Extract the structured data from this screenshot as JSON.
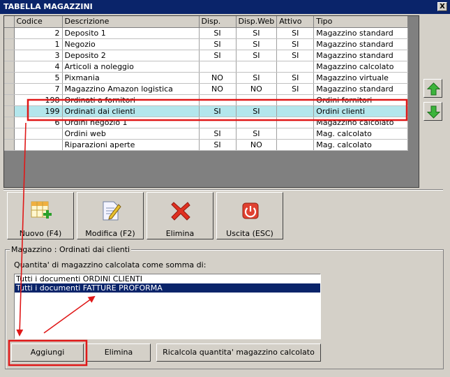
{
  "window": {
    "title": "TABELLA MAGAZZINI",
    "close_label": "X"
  },
  "grid": {
    "columns": [
      "Codice",
      "Descrizione",
      "Disp.",
      "Disp.Web",
      "Attivo",
      "Tipo"
    ],
    "rows": [
      [
        "2",
        "Deposito 1",
        "SI",
        "SI",
        "SI",
        "Magazzino standard"
      ],
      [
        "1",
        "Negozio",
        "SI",
        "SI",
        "SI",
        "Magazzino standard"
      ],
      [
        "3",
        "Deposito 2",
        "SI",
        "SI",
        "SI",
        "Magazzino standard"
      ],
      [
        "4",
        "Articoli a noleggio",
        "",
        "",
        "",
        "Magazzino calcolato"
      ],
      [
        "5",
        "Pixmania",
        "NO",
        "SI",
        "SI",
        "Magazzino virtuale"
      ],
      [
        "7",
        "Magazzino Amazon logistica",
        "NO",
        "NO",
        "SI",
        "Magazzino standard"
      ],
      [
        "198",
        "Ordinati a fornitori",
        "",
        "",
        "",
        "Ordini fornitori"
      ],
      [
        "199",
        "Ordinati dai clienti",
        "SI",
        "SI",
        "",
        "Ordini clienti"
      ],
      [
        "6",
        "Ordini negozio 1",
        "",
        "",
        "",
        "Magazzino calcolato"
      ],
      [
        "",
        "Ordini web",
        "SI",
        "SI",
        "",
        "Mag. calcolato"
      ],
      [
        "",
        "Riparazioni aperte",
        "SI",
        "NO",
        "",
        "Mag. calcolato"
      ]
    ],
    "selected_row": 7
  },
  "side_buttons": {
    "up_icon": "arrow-up-icon",
    "down_icon": "arrow-down-icon"
  },
  "toolbar": {
    "new_label": "Nuovo (F4)",
    "edit_label": "Modifica (F2)",
    "delete_label": "Elimina",
    "exit_label": "Uscita (ESC)"
  },
  "detail": {
    "group_title": "Magazzino : Ordinati dai clienti",
    "caption": "Quantita' di magazzino calcolata come somma di:",
    "list_items": [
      "Tutti i documenti ORDINI CLIENTI",
      "Tutti i documenti FATTURE PROFORMA"
    ],
    "selected_item": 1,
    "add_label": "Aggiungi",
    "remove_label": "Elimina",
    "recalc_label": "Ricalcola quantita' magazzino calcolato"
  },
  "colors": {
    "annotation": "#e01818",
    "title_bar": "#0a246a",
    "row_highlight": "#b3e6ec"
  }
}
